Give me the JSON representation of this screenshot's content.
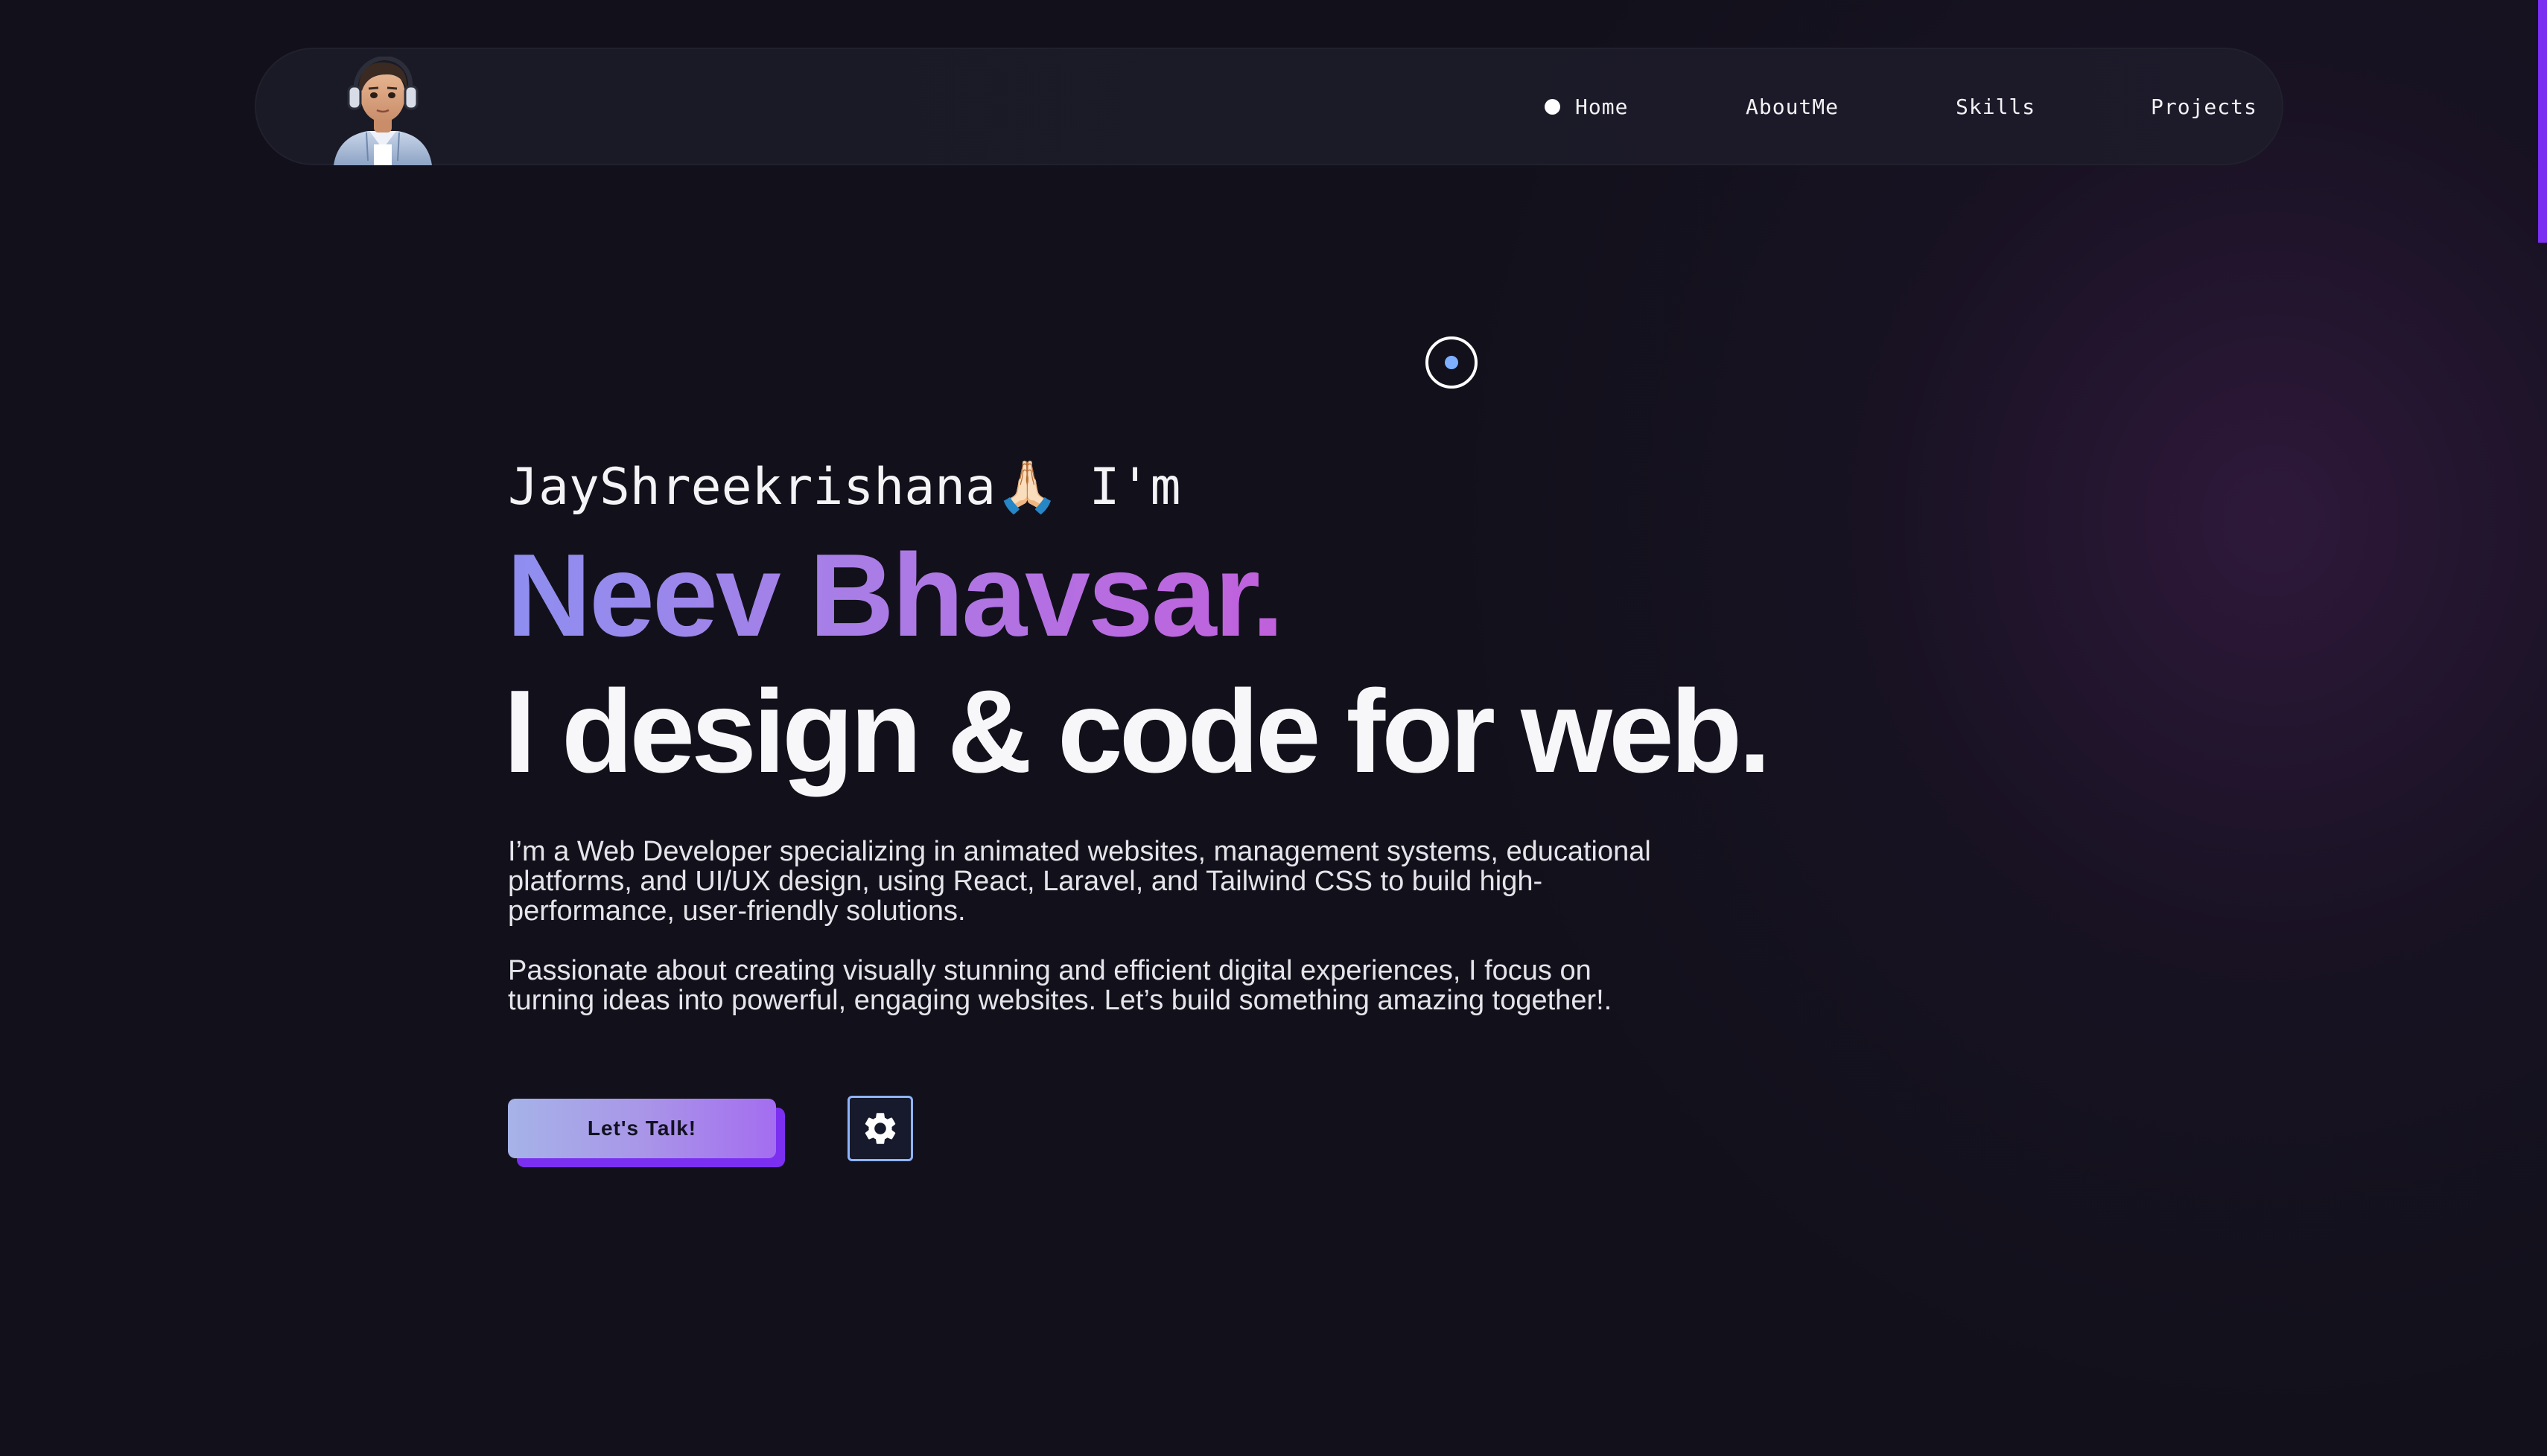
{
  "nav": {
    "items": [
      {
        "label": "Home",
        "active": true
      },
      {
        "label": "AboutMe"
      },
      {
        "label": "Skills"
      },
      {
        "label": "Projects"
      }
    ]
  },
  "hero": {
    "greeting": "JayShreekrishana🙏🏻 I'm",
    "name": "Neev Bhavsar.",
    "tagline": "I design & code for web.",
    "paragraph1": "I’m a Web Developer specializing in animated websites, management systems, educational platforms, and UI/UX design, using React, Laravel, and Tailwind CSS to build high-performance, user-friendly solutions.",
    "paragraph2": "Passionate about creating visually stunning and efficient digital experiences, I focus on turning ideas into powerful, engaging websites. Let’s build something amazing together!.",
    "cta_label": "Let's Talk!"
  },
  "colors": {
    "background": "#12111b",
    "accent": "#7b2ff0",
    "name_gradient_start": "#8e8ff0",
    "name_gradient_end": "#c160dc"
  },
  "icons": {
    "settings": "gear-icon",
    "avatar": "avatar-illustration"
  }
}
